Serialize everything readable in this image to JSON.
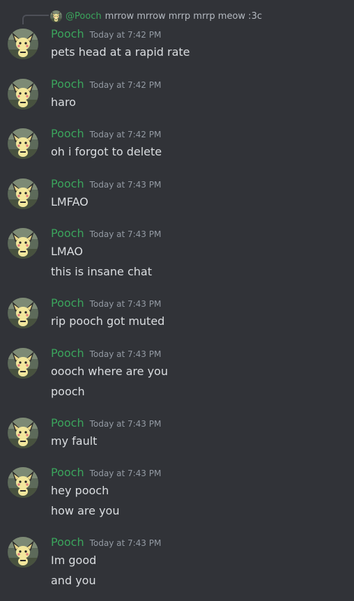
{
  "reply": {
    "mention": "@Pooch",
    "text": "mrrow mrrow mrrp mrrp meow :3c"
  },
  "messages": [
    {
      "username": "Pooch",
      "timestamp": "Today at 7:42 PM",
      "lines": [
        "pets head at a rapid rate"
      ]
    },
    {
      "username": "Pooch",
      "timestamp": "Today at 7:42 PM",
      "lines": [
        "haro"
      ]
    },
    {
      "username": "Pooch",
      "timestamp": "Today at 7:42 PM",
      "lines": [
        "oh i forgot to delete"
      ]
    },
    {
      "username": "Pooch",
      "timestamp": "Today at 7:43 PM",
      "lines": [
        "LMFAO"
      ]
    },
    {
      "username": "Pooch",
      "timestamp": "Today at 7:43 PM",
      "lines": [
        "LMAO",
        "this is insane chat"
      ]
    },
    {
      "username": "Pooch",
      "timestamp": "Today at 7:43 PM",
      "lines": [
        "rip pooch got muted"
      ]
    },
    {
      "username": "Pooch",
      "timestamp": "Today at 7:43 PM",
      "lines": [
        "oooch where are you",
        "pooch"
      ]
    },
    {
      "username": "Pooch",
      "timestamp": "Today at 7:43 PM",
      "lines": [
        "my fault"
      ]
    },
    {
      "username": "Pooch",
      "timestamp": "Today at 7:43 PM",
      "lines": [
        "hey pooch",
        "how are you"
      ]
    },
    {
      "username": "Pooch",
      "timestamp": "Today at 7:43 PM",
      "lines": [
        "Im good",
        "and you"
      ]
    }
  ],
  "colors": {
    "background": "#313338",
    "username": "#3ba55c",
    "timestamp": "#949ba4",
    "text": "#dbdee1"
  }
}
